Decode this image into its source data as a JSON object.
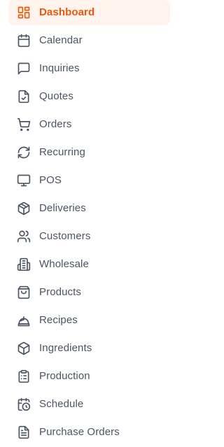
{
  "nav": {
    "items": [
      {
        "label": "Dashboard",
        "icon": "dashboard-icon",
        "active": true
      },
      {
        "label": "Calendar",
        "icon": "calendar-icon",
        "active": false
      },
      {
        "label": "Inquiries",
        "icon": "chat-bubble-icon",
        "active": false
      },
      {
        "label": "Quotes",
        "icon": "document-check-icon",
        "active": false
      },
      {
        "label": "Orders",
        "icon": "shopping-cart-icon",
        "active": false
      },
      {
        "label": "Recurring",
        "icon": "refresh-icon",
        "active": false
      },
      {
        "label": "POS",
        "icon": "monitor-icon",
        "active": false
      },
      {
        "label": "Deliveries",
        "icon": "package-icon",
        "active": false
      },
      {
        "label": "Customers",
        "icon": "users-icon",
        "active": false
      },
      {
        "label": "Wholesale",
        "icon": "building-icon",
        "active": false
      },
      {
        "label": "Products",
        "icon": "shopping-bag-icon",
        "active": false
      },
      {
        "label": "Recipes",
        "icon": "chef-hat-icon",
        "active": false
      },
      {
        "label": "Ingredients",
        "icon": "box-icon",
        "active": false
      },
      {
        "label": "Production",
        "icon": "clipboard-list-icon",
        "active": false
      },
      {
        "label": "Schedule",
        "icon": "calendar-clock-icon",
        "active": false
      },
      {
        "label": "Purchase Orders",
        "icon": "file-text-icon",
        "active": false
      }
    ]
  },
  "colors": {
    "active_text": "#ea580c",
    "active_bg": "#fff4ed",
    "text": "#4b5563",
    "icon": "#4b5563"
  }
}
